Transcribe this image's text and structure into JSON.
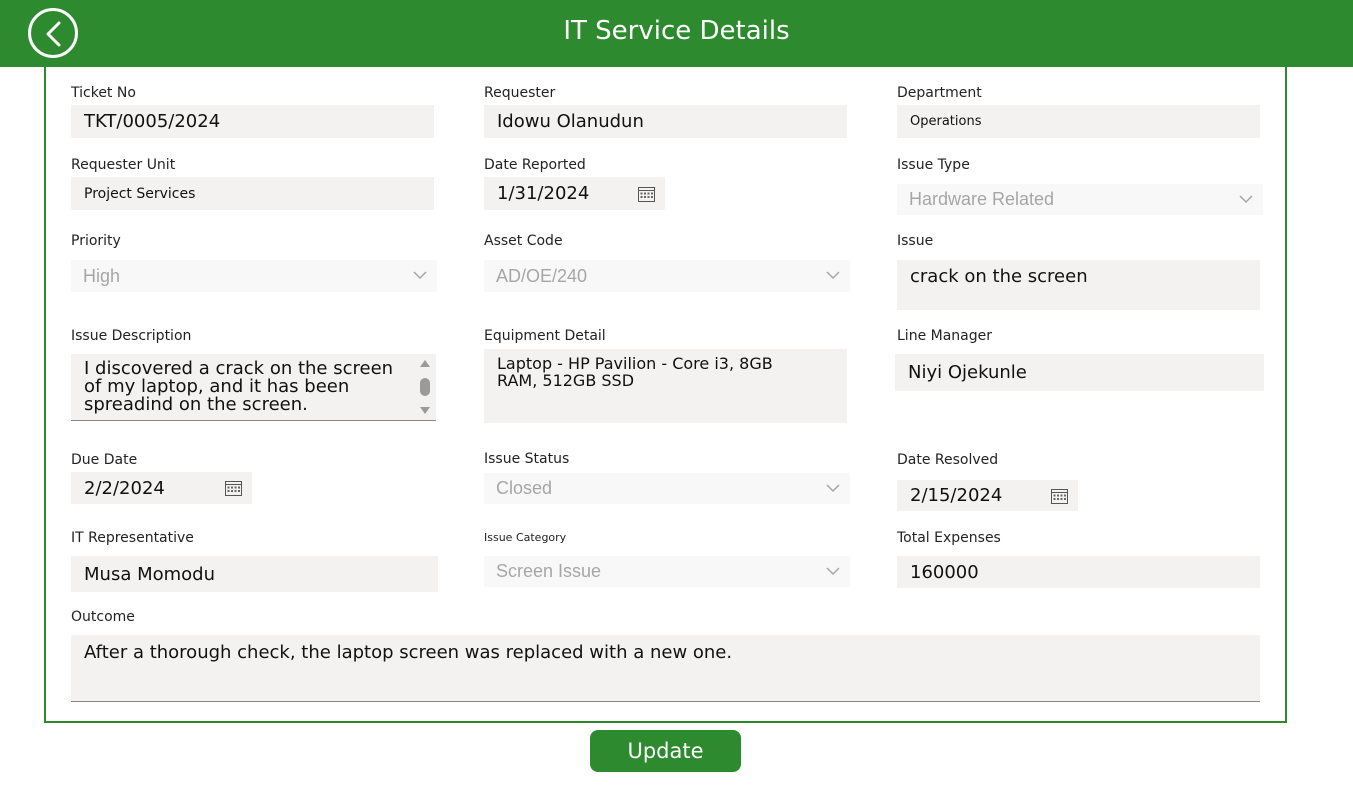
{
  "header": {
    "title": "IT Service Details"
  },
  "fields": {
    "ticket_no": {
      "label": "Ticket No",
      "value": "TKT/0005/2024"
    },
    "requester": {
      "label": "Requester",
      "value": "Idowu Olanudun"
    },
    "department": {
      "label": "Department",
      "value": "Operations"
    },
    "requester_unit": {
      "label": "Requester Unit",
      "value": "Project Services"
    },
    "date_reported": {
      "label": "Date Reported",
      "value": "1/31/2024"
    },
    "issue_type": {
      "label": "Issue Type",
      "value": "Hardware Related"
    },
    "priority": {
      "label": "Priority",
      "value": "High"
    },
    "asset_code": {
      "label": "Asset Code",
      "value": "AD/OE/240"
    },
    "issue": {
      "label": "Issue",
      "value": "crack on the screen"
    },
    "issue_description": {
      "label": "Issue Description",
      "value": "I discovered a crack on the screen of my laptop, and it has been spreadind on the screen."
    },
    "equipment_detail": {
      "label": "Equipment Detail",
      "value": "Laptop - HP Pavilion - Core i3, 8GB RAM, 512GB SSD"
    },
    "line_manager": {
      "label": "Line Manager",
      "value": "Niyi Ojekunle"
    },
    "due_date": {
      "label": "Due Date",
      "value": "2/2/2024"
    },
    "issue_status": {
      "label": "Issue Status",
      "value": "Closed"
    },
    "date_resolved": {
      "label": "Date Resolved",
      "value": "2/15/2024"
    },
    "it_representative": {
      "label": "IT Representative",
      "value": "Musa Momodu"
    },
    "issue_category": {
      "label": "Issue Category",
      "value": "Screen Issue"
    },
    "total_expenses": {
      "label": "Total Expenses",
      "value": "160000"
    },
    "outcome": {
      "label": "Outcome",
      "value": "After a thorough check, the laptop screen was replaced with a new one."
    }
  },
  "actions": {
    "update_label": "Update"
  },
  "colors": {
    "brand": "#2e8a2e",
    "field_bg": "#f3f2f1",
    "disabled_text": "#a6a6a6"
  },
  "icons": {
    "back": "chevron-left-icon",
    "calendar": "calendar-icon",
    "dropdown": "chevron-down-icon"
  }
}
